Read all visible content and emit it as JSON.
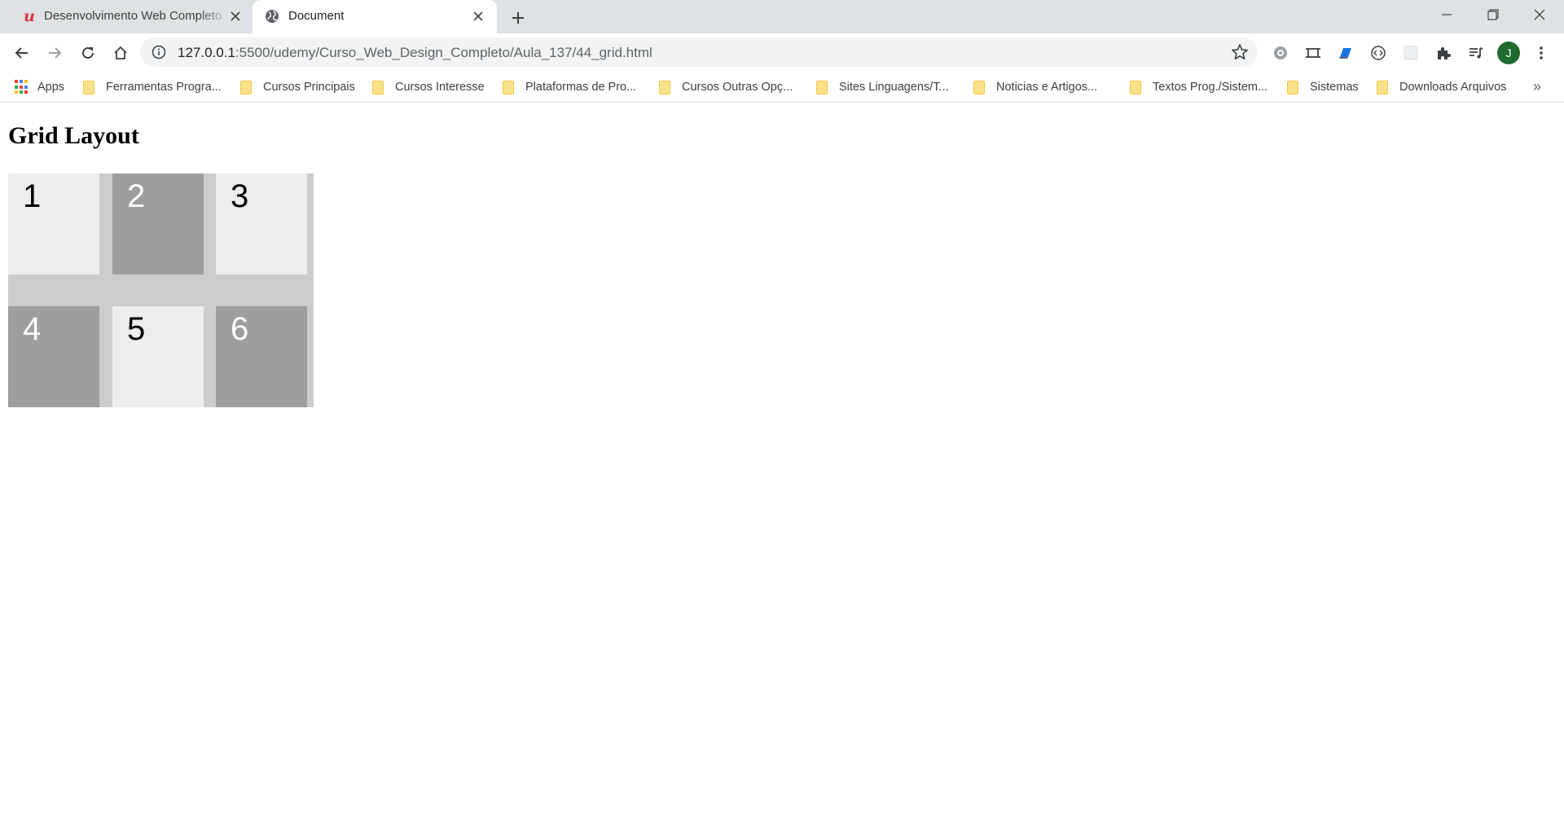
{
  "tabs": [
    {
      "title": "Desenvolvimento Web Completo",
      "active": false,
      "favicon": "udemy-logo-icon"
    },
    {
      "title": "Document",
      "active": true,
      "favicon": "globe-icon"
    }
  ],
  "udemy_logo_text": "u",
  "address_bar": {
    "host": "127.0.0.1",
    "path": ":5500/udemy/Curso_Web_Design_Completo/Aula_137/44_grid.html"
  },
  "profile": {
    "initial": "J",
    "color": "#1e6b2d"
  },
  "bookmarks": {
    "apps_label": "Apps",
    "items": [
      "Ferramentas Progra...",
      "Cursos Principais",
      "Cursos Interesse",
      "Plataformas de Pro...",
      "Cursos Outras Opç...",
      "Sites Linguagens/T...",
      "Noticias e Artigos...",
      "Textos Prog./Sistem...",
      "Sistemas",
      "Downloads Arquivos"
    ],
    "overflow": "»"
  },
  "page": {
    "heading": "Grid Layout",
    "cells": [
      "1",
      "2",
      "3",
      "4",
      "5",
      "6"
    ]
  },
  "colors": {
    "grid_background": "#cccccc",
    "cell_light": "#ededed",
    "cell_dark": "#9e9e9e"
  }
}
